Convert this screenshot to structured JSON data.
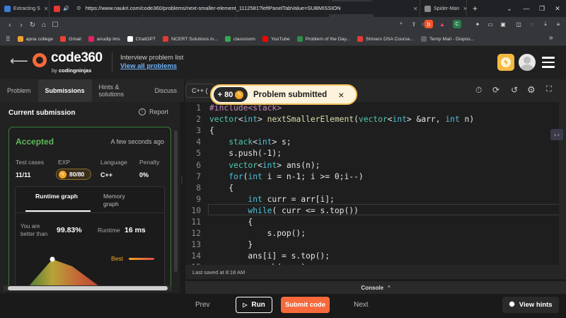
{
  "browser": {
    "tabs": [
      {
        "label": "Extracting S",
        "color": "#3b7dd8"
      },
      {
        "label": "Matsu",
        "color": "#e53935",
        "audio": true
      },
      {
        "label": "My Courses",
        "color": "#f0a030"
      },
      {
        "label": "My Courses",
        "color": "#f0a030"
      },
      {
        "label": "Selecting El",
        "color": "#f0a030"
      },
      {
        "label": "JS DOM - G",
        "color": "#5b9bd5"
      },
      {
        "label": "(14) WhatsA",
        "color": "#25d366"
      },
      {
        "label": "Nex",
        "color": "#3b82f6",
        "audio": true,
        "active": true
      },
      {
        "label": "Document",
        "color": "#8a8a8a"
      },
      {
        "label": "Spider-Man",
        "color": "#8a8a8a"
      }
    ],
    "new_tab": "+",
    "url": "https://www.naukri.com/code360/problems/next-smaller-element_1112581?leftPanelTabValue=SUBMISSION",
    "bookmarks": [
      {
        "label": "apna college",
        "color": "#f0a030"
      },
      {
        "label": "Gmail",
        "color": "#ea4335"
      },
      {
        "label": "anudip lms",
        "color": "#e91e63"
      },
      {
        "label": "ChatGPT",
        "color": "#ffffff"
      },
      {
        "label": "NCERT Solutions in...",
        "color": "#e53935"
      },
      {
        "label": "classroom",
        "color": "#34a853"
      },
      {
        "label": "YouTube",
        "color": "#ff0000"
      },
      {
        "label": "Problem of the Day...",
        "color": "#2f8d46"
      },
      {
        "label": "Strivers DSA Course...",
        "color": "#e53935"
      },
      {
        "label": "Temp Mail - Dispos...",
        "color": "#5f6368"
      }
    ],
    "more": "»"
  },
  "header": {
    "logo_main": "code",
    "logo_num": "360",
    "logo_by": "by",
    "logo_brand": "codingninjas",
    "list_title": "Interview problem list",
    "list_link": "View all problems"
  },
  "left_tabs": [
    "Problem",
    "Submissions",
    "Hints & solutions",
    "Discuss"
  ],
  "language_tab": "C++ (",
  "submission": {
    "title": "Current submission",
    "report": "Report",
    "status": "Accepted",
    "time": "A few seconds ago",
    "labels": {
      "test_cases": "Test cases",
      "exp": "EXP",
      "language": "Language",
      "penalty": "Penalty"
    },
    "values": {
      "test_cases": "11/11",
      "exp": "80/80",
      "language": "C++",
      "penalty": "0%"
    },
    "graph_tabs": [
      "Runtime graph",
      "Memory graph"
    ],
    "better_label": "You are better than",
    "better_value": "99.83%",
    "runtime_label": "Runtime",
    "runtime_value": "16 ms",
    "best_label": "Best"
  },
  "toast": {
    "points": "+ 80",
    "message": "Problem submitted",
    "close": "×"
  },
  "code_lines": [
    {
      "n": "1",
      "text": "#include<stack>"
    },
    {
      "n": "2",
      "text": "vector<int> nextSmallerElement(vector<int> &arr, int n)"
    },
    {
      "n": "3",
      "text": "{"
    },
    {
      "n": "4",
      "text": "    stack<int> s;"
    },
    {
      "n": "5",
      "text": "    s.push(-1);"
    },
    {
      "n": "6",
      "text": "    vector<int> ans(n);"
    },
    {
      "n": "7",
      "text": "    for(int i = n-1; i >= 0;i--)"
    },
    {
      "n": "8",
      "text": "    {"
    },
    {
      "n": "9",
      "text": "        int curr = arr[i];"
    },
    {
      "n": "10",
      "text": "        while( curr <= s.top())"
    },
    {
      "n": "11",
      "text": "        {"
    },
    {
      "n": "12",
      "text": "            s.pop();"
    },
    {
      "n": "13",
      "text": "        }"
    },
    {
      "n": "14",
      "text": "        ans[i] = s.top();"
    },
    {
      "n": "15",
      "text": "        s.push(curr);"
    }
  ],
  "saved": "Last saved at 8:18 AM",
  "console": "Console",
  "bottom": {
    "prev": "Prev",
    "run": "Run",
    "submit": "Submit code",
    "next": "Next",
    "hints": "View hints"
  },
  "colors": {
    "accent": "#f86a3b",
    "accepted": "#5fb85b",
    "toast_border": "#f4c15a",
    "coin": "#f5a623"
  }
}
